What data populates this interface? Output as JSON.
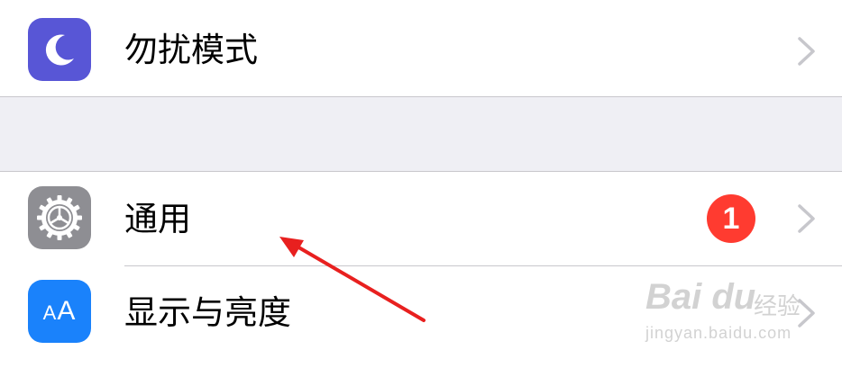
{
  "settings": {
    "rows": [
      {
        "label": "勿扰模式",
        "icon": "moon-icon",
        "icon_bg": "#5856d6"
      },
      {
        "label": "通用",
        "icon": "gear-icon",
        "icon_bg": "#8e8e93",
        "badge": "1"
      },
      {
        "label": "显示与亮度",
        "icon": "text-size-icon",
        "icon_bg": "#1a82fb",
        "icon_text_small": "A",
        "icon_text_large": "A"
      }
    ]
  },
  "annotation": {
    "arrow_color": "#e8201f"
  },
  "watermark": {
    "brand": "Bai du",
    "product": "经验",
    "url": "jingyan.baidu.com"
  },
  "colors": {
    "badge": "#ff3b30",
    "separator": "#c8c7cc",
    "group_bg": "#efeff4",
    "chevron": "#c7c7cc"
  }
}
